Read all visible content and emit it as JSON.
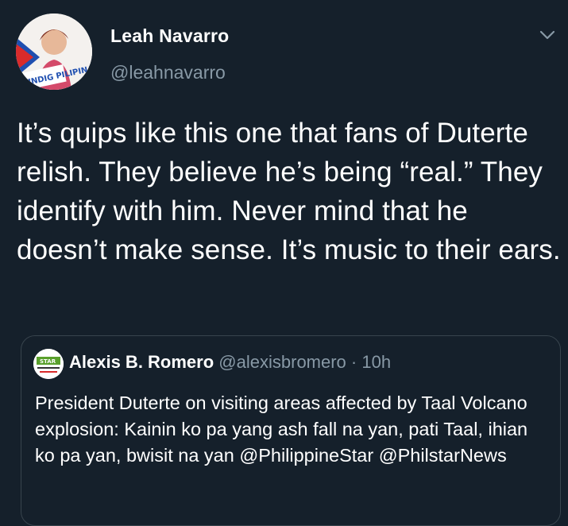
{
  "tweet": {
    "display_name": "Leah Navarro",
    "handle": "@leahnavarro",
    "avatar_badge_text": "TINDIG PILIPINAS!",
    "text": "It’s quips like this one that fans of Duterte relish. They believe he’s being “real.” They identify with him. Never mind that he doesn’t make sense. It’s music to their ears."
  },
  "quoted_tweet": {
    "display_name": "Alexis B. Romero",
    "handle": "@alexisbromero",
    "separator": "·",
    "time": "10h",
    "avatar_text": "STAR",
    "text": "President Duterte on visiting areas affected by Taal Volcano explosion: Kainin ko pa yang ash fall na yan, pati Taal, ihian ko pa yan, bwisit na yan @PhilippineStar @PhilstarNews"
  },
  "icons": {
    "menu": "chevron-down-icon"
  },
  "colors": {
    "background": "#15202b",
    "primary_text": "#ffffff",
    "secondary_text": "#8899a6",
    "border": "#38444d"
  }
}
